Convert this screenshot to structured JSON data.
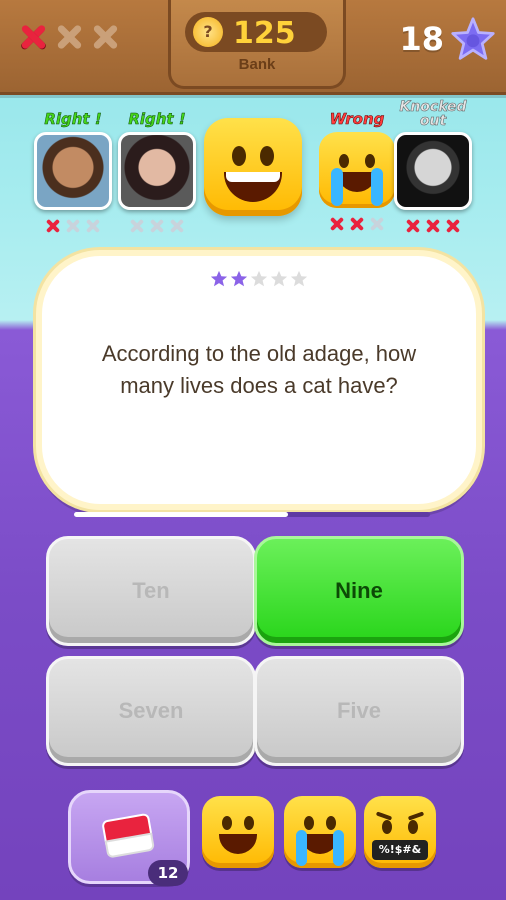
{
  "header": {
    "lives": [
      {
        "icon": "red-x-icon",
        "lost": true
      },
      {
        "icon": "x-icon",
        "lost": false
      },
      {
        "icon": "x-icon",
        "lost": false
      }
    ],
    "coins": "125",
    "coin_icon_glyph": "?",
    "bank_label": "Bank",
    "level": "18",
    "level_star_icon": "star-icon",
    "colors": {
      "bar": "#9c6432",
      "coins": "#ffd23a",
      "star": "#7c6cf2"
    }
  },
  "players": [
    {
      "status": "Right !",
      "type": "right",
      "strikes": [
        true,
        false,
        false
      ],
      "avatar": "player-photo"
    },
    {
      "status": "Right !",
      "type": "right",
      "strikes": [
        false,
        false,
        false
      ],
      "avatar": "player-photo"
    },
    {
      "status": "",
      "type": "self",
      "avatar": "grinning-emoji-icon"
    },
    {
      "status": "Wrong",
      "type": "wrong",
      "strikes": [
        true,
        true,
        false
      ],
      "avatar": "crying-emoji-icon"
    },
    {
      "status": "Knocked out",
      "type": "knocked",
      "strikes": [
        true,
        true,
        true
      ],
      "avatar": "player-photo"
    }
  ],
  "question": {
    "difficulty_filled": 2,
    "difficulty_total": 5,
    "text": "According to the old adage, how many lives does a cat have?",
    "timer_remaining": 0.6
  },
  "answers": [
    {
      "label": "Ten",
      "state": "disabled"
    },
    {
      "label": "Nine",
      "state": "correct"
    },
    {
      "label": "Seven",
      "state": "disabled"
    },
    {
      "label": "Five",
      "state": "disabled"
    }
  ],
  "bottom": {
    "powerup_icon": "eraser-icon",
    "powerup_count": "12",
    "reactions": [
      "grinning-emoji-icon",
      "crying-emoji-icon",
      "angry-swearing-emoji-icon"
    ],
    "swear_text": "%!$#&"
  }
}
